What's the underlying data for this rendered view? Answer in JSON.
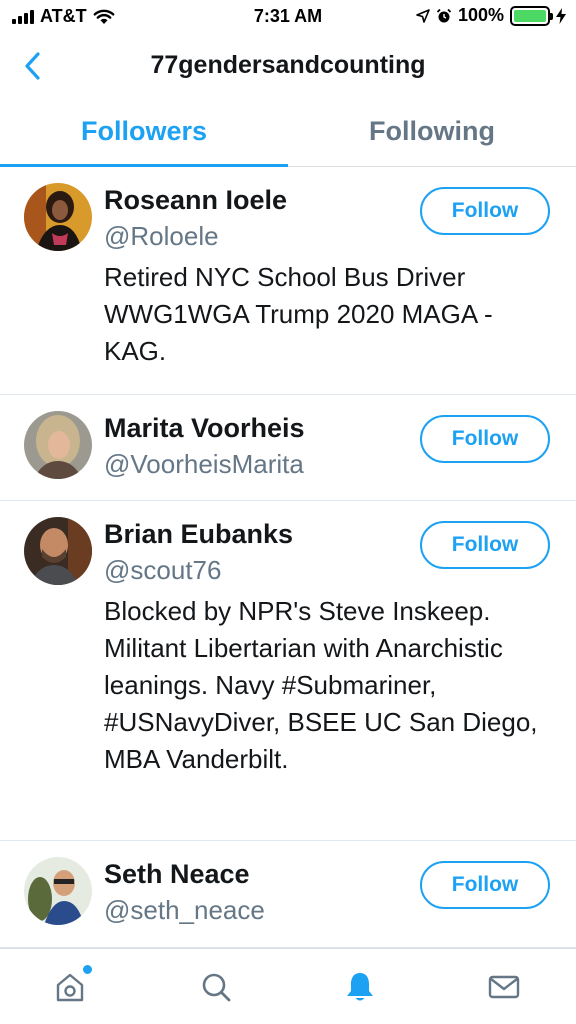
{
  "status_bar": {
    "carrier": "AT&T",
    "time": "7:31 AM",
    "battery": "100%",
    "battery_level": 1.0,
    "icons": [
      "signal-icon",
      "wifi-icon",
      "location-icon",
      "alarm-icon",
      "battery-icon",
      "charging-icon"
    ]
  },
  "header": {
    "title": "77gendersandcounting",
    "back_icon": "chevron-left-icon"
  },
  "tabs": [
    {
      "label": "Followers",
      "active": true
    },
    {
      "label": "Following",
      "active": false
    }
  ],
  "users": [
    {
      "name": "Roseann Ioele",
      "handle": "@Roloele",
      "bio": "Retired NYC School Bus Driver WWG1WGA Trump 2020 MAGA - KAG.",
      "follow_label": "Follow"
    },
    {
      "name": "Marita Voorheis",
      "handle": "@VoorheisMarita",
      "bio": "",
      "follow_label": "Follow"
    },
    {
      "name": "Brian Eubanks",
      "handle": "@scout76",
      "bio": "Blocked by NPR's Steve Inskeep. Militant Libertarian with Anarchistic leanings. Navy #Submariner, #USNavyDiver, BSEE UC San Diego, MBA Vanderbilt.",
      "follow_label": "Follow"
    },
    {
      "name": "Seth Neace",
      "handle": "@seth_neace",
      "bio": "",
      "follow_label": "Follow"
    }
  ],
  "tab_bar": {
    "items": [
      "home-icon",
      "search-icon",
      "notifications-icon",
      "messages-icon"
    ],
    "active": "notifications-icon",
    "colors": {
      "active": "#1da1f2",
      "inactive": "#657786"
    }
  },
  "colors": {
    "accent": "#1da1f2",
    "secondary_text": "#657786",
    "primary_text": "#14171a",
    "battery_fill": "#4cd964"
  }
}
